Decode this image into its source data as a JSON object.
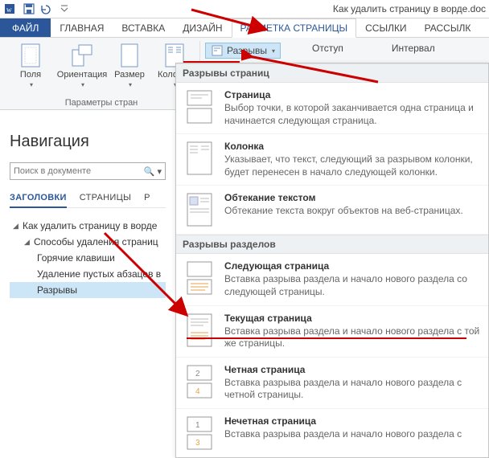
{
  "titlebar": {
    "doc_title": "Как удалить страницу в ворде.doc"
  },
  "ribbon": {
    "tabs": {
      "file": "ФАЙЛ",
      "home": "ГЛАВНАЯ",
      "insert": "ВСТАВКА",
      "design": "ДИЗАЙН",
      "pagelayout": "РАЗМЕТКА СТРАНИЦЫ",
      "references": "ССЫЛКИ",
      "mailings": "РАССЫЛК"
    },
    "group1": {
      "margins": "Поля",
      "orientation": "Ориентация",
      "size": "Размер",
      "columns": "Колонки",
      "label": "Параметры стран"
    },
    "group2": {
      "breaks": "Разрывы"
    },
    "group3": {
      "indent": "Отступ",
      "spacing": "Интервал"
    }
  },
  "navigation": {
    "title": "Навигация",
    "search_placeholder": "Поиск в документе",
    "tabs": {
      "headings": "ЗАГОЛОВКИ",
      "pages": "СТРАНИЦЫ",
      "results": "Р"
    },
    "tree": {
      "n1": "Как удалить страницу в ворде",
      "n2": "Способы удаления страниц",
      "n3": "Горячие клавиши",
      "n4": "Удаление пустых абзацев в",
      "n5": "Разрывы"
    }
  },
  "menu": {
    "section1": "Разрывы страниц",
    "i1t": "Страница",
    "i1d": "Выбор точки, в которой заканчивается одна страница и начинается следующая страница.",
    "i2t": "Колонка",
    "i2d": "Указывает, что текст, следующий за разрывом колонки, будет перенесен в начало следующей колонки.",
    "i3t": "Обтекание текстом",
    "i3d": "Обтекание текста вокруг объектов на веб-страницах.",
    "section2": "Разрывы разделов",
    "i4t": "Следующая страница",
    "i4d": "Вставка разрыва раздела и начало нового раздела со следующей страницы.",
    "i5t": "Текущая страница",
    "i5d": "Вставка разрыва раздела и начало нового раздела с той же страницы.",
    "i6t": "Четная страница",
    "i6d": "Вставка разрыва раздела и начало нового раздела с четной страницы.",
    "i7t": "Нечетная страница",
    "i7d": "Вставка разрыва раздела и начало нового раздела с"
  }
}
